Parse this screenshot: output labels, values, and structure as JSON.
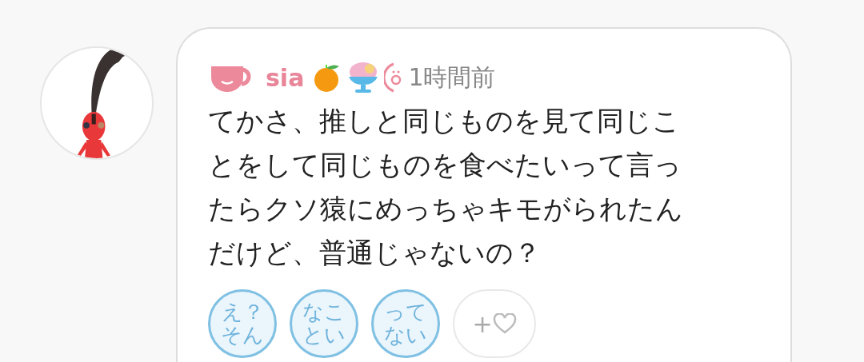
{
  "post": {
    "author": "sia",
    "time": "1時間前",
    "body_lines": [
      "てかさ、推しと同じものを見て同じこ",
      "とをして同じものを食べたいって言っ",
      "たらクソ猿にめっちゃキモがられたん",
      "だけど、普通じゃないの？"
    ],
    "reactions": [
      {
        "kind": "stamp",
        "lines": [
          "え？",
          "そん"
        ]
      },
      {
        "kind": "stamp",
        "lines": [
          "なこ",
          "とい"
        ]
      },
      {
        "kind": "stamp",
        "lines": [
          "って",
          "ない"
        ]
      },
      {
        "kind": "add",
        "label": "+"
      }
    ]
  }
}
